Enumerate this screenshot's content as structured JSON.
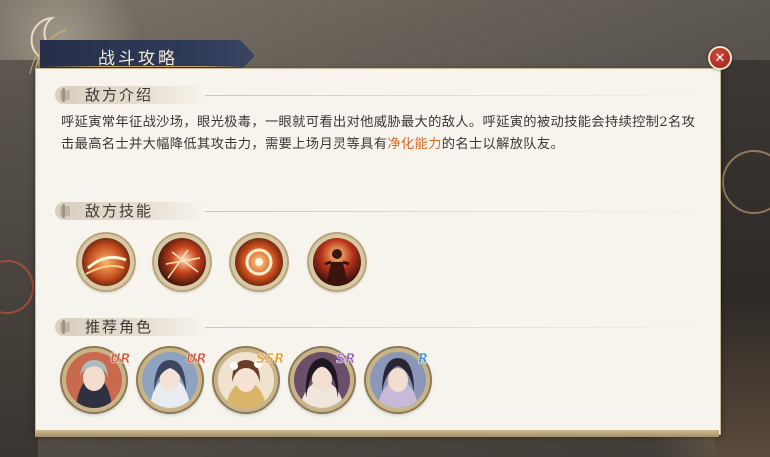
{
  "window": {
    "title": "战斗攻略",
    "close_icon": "close-icon"
  },
  "sections": {
    "intro": {
      "label": "敌方介绍",
      "text_before": "呼延寅常年征战沙场，眼光极毒，一眼就可看出对他威胁最大的敌人。呼延寅的被动技能会持续控制2名攻击最高名士并大幅降低其攻击力，需要上场月灵等具有",
      "highlight": "净化能力",
      "text_after": "的名士以解放队友。",
      "highlight_color": "#d56a25"
    },
    "skills": {
      "label": "敌方技能",
      "items": [
        {
          "icon": "fire-slash-icon"
        },
        {
          "icon": "fire-burst-icon"
        },
        {
          "icon": "fire-ring-icon"
        },
        {
          "icon": "warrior-aura-icon"
        }
      ]
    },
    "recommended": {
      "label": "推荐角色",
      "characters": [
        {
          "rarity": "UR",
          "rarity_color": "#e0573a",
          "avatar": "character-avatar"
        },
        {
          "rarity": "UR",
          "rarity_color": "#e0573a",
          "avatar": "character-avatar"
        },
        {
          "rarity": "SSR",
          "rarity_color": "#e59a2a",
          "avatar": "character-avatar"
        },
        {
          "rarity": "SR",
          "rarity_color": "#9a5fc9",
          "avatar": "character-avatar"
        },
        {
          "rarity": "R",
          "rarity_color": "#3c8fd6",
          "avatar": "character-avatar"
        }
      ]
    }
  }
}
